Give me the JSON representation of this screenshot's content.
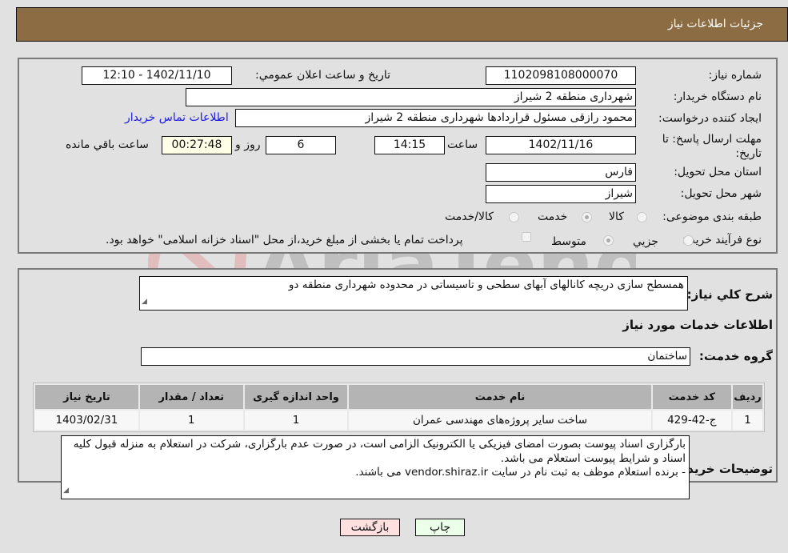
{
  "header": {
    "title": "جزئیات اطلاعات نیاز"
  },
  "details": {
    "need_number": {
      "label": "شماره نیاز:",
      "value": "1102098108000070"
    },
    "announce_datetime": {
      "label": "تاریخ و ساعت اعلان عمومي:",
      "value": "1402/11/10 - 12:10"
    },
    "buyer_org": {
      "label": "نام دستگاه خریدار:",
      "value": "شهرداری منطقه 2 شیراز"
    },
    "requester": {
      "label": "ایجاد کننده درخواست:",
      "value": "محمود رازقی مسئول قراردادها شهرداری منطقه 2 شیراز"
    },
    "buyer_contact_link": "اطلاعات تماس خریدار",
    "deadline": {
      "label": "مهلت ارسال پاسخ: تا تاریخ:",
      "date": "1402/11/16",
      "time_label": "ساعت",
      "time": "14:15",
      "days": "6",
      "days_label": "روز و",
      "remaining": "00:27:48",
      "remaining_label": "ساعت باقي مانده"
    },
    "province": {
      "label": "استان محل تحویل:",
      "value": "فارس"
    },
    "city": {
      "label": "شهر محل تحویل:",
      "value": "شیراز"
    },
    "category": {
      "label": "طبقه بندی موضوعی:",
      "options": [
        "کالا",
        "خدمت",
        "کالا/خدمت"
      ],
      "selected": "خدمت"
    },
    "purchase_type": {
      "label": "نوع فرآیند خرید :",
      "options": [
        "جزیي",
        "متوسط"
      ],
      "selected": "متوسط",
      "treasury_checkbox_label": "پرداخت تمام یا بخشی از مبلغ خرید،از محل \"اسناد خزانه اسلامی\" خواهد بود."
    }
  },
  "needs": {
    "summary_label": "شرح کلي نياز:",
    "summary": "همسطح سازی دریچه کانالهای آبهای سطحی و تاسیساتی در محدوده شهرداری منطقه دو",
    "services_title": "اطلاعات خدمات مورد نياز",
    "service_group_label": "گروه خدمت:",
    "service_group": "ساختمان",
    "table": {
      "headers": [
        "رديف",
        "کد خدمت",
        "نام خدمت",
        "واحد اندازه گیری",
        "تعداد / مقدار",
        "تاریخ نیاز"
      ],
      "rows": [
        [
          "1",
          "ج-42-429",
          "ساخت سایر پروژه‌های مهندسی عمران",
          "1",
          "1",
          "1403/02/31"
        ]
      ]
    },
    "buyer_notes_label": "توضیحات خریدار:",
    "buyer_notes": [
      "بارگزاری اسناد پیوست بصورت امضای فیزیکی یا الکترونیک الزامی است، در صورت عدم بارگزاری، شرکت در استعلام به منزله قبول کلیه اسناد و شرایط پیوست استعلام می باشد.",
      "- برنده استعلام موظف به ثبت نام در سایت vendor.shiraz.ir می باشند."
    ]
  },
  "buttons": {
    "print": "چاپ",
    "back": "بازگشت"
  },
  "watermark": "AriaTender.neT"
}
